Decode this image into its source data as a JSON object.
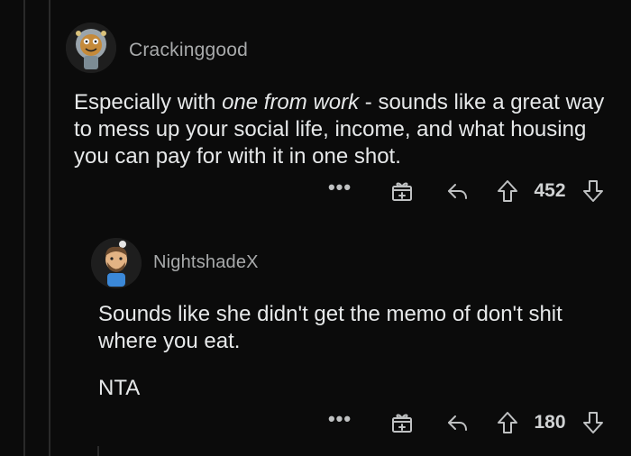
{
  "comments": [
    {
      "username": "Crackinggood",
      "body_before": "Especially with ",
      "body_emphasis": "one from work",
      "body_after": " - sounds like a great way to mess up your social life, income, and what housing you can pay for with it in one shot.",
      "score": "452",
      "more_label": "•••"
    },
    {
      "username": "NightshadeX",
      "paragraph_1": "Sounds like she didn't get the memo of don't shit where you eat.",
      "paragraph_2": "NTA",
      "score": "180",
      "more_label": "•••"
    }
  ],
  "icons": {
    "more": "more-options-icon",
    "award": "award-icon",
    "reply": "reply-icon",
    "upvote": "upvote-arrow-icon",
    "downvote": "downvote-arrow-icon"
  },
  "colors": {
    "background": "#0b0b0b",
    "thread_line": "#2a2a2a",
    "username": "#a8aaab",
    "body_text": "#e6e8e9"
  }
}
